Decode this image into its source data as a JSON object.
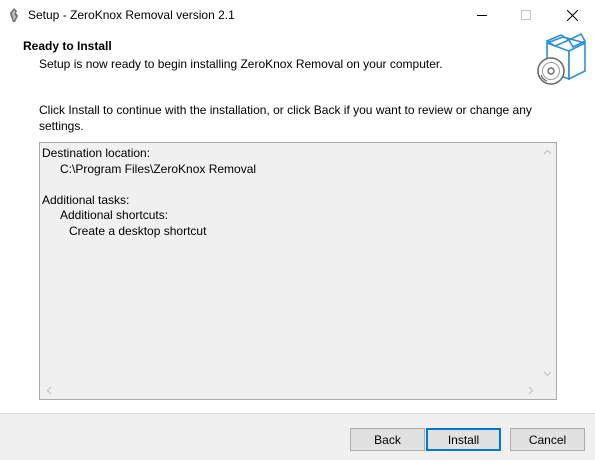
{
  "window": {
    "title": "Setup - ZeroKnox Removal version 2.1",
    "controls": {
      "minimize": "—",
      "maximize": "☐",
      "close": "✕"
    }
  },
  "header": {
    "title": "Ready to Install",
    "subtitle": "Setup is now ready to begin installing ZeroKnox Removal on your computer.",
    "graphic_icon": "installer-box-disc-icon"
  },
  "instructions": "Click Install to continue with the installation, or click Back if you want to review or change any settings.",
  "memo": {
    "destination_heading": "Destination location:",
    "destination_path": "C:\\Program Files\\ZeroKnox Removal",
    "tasks_heading": "Additional tasks:",
    "shortcuts_heading": "Additional shortcuts:",
    "shortcut_item": "Create a desktop shortcut"
  },
  "buttons": {
    "back": "Back",
    "install": "Install",
    "cancel": "Cancel"
  },
  "colors": {
    "focus_border": "#0078d7",
    "footer_bg": "#f0f0f0",
    "memo_bg": "#f0f0f0",
    "graphic_blue": "#2b8fd6"
  }
}
